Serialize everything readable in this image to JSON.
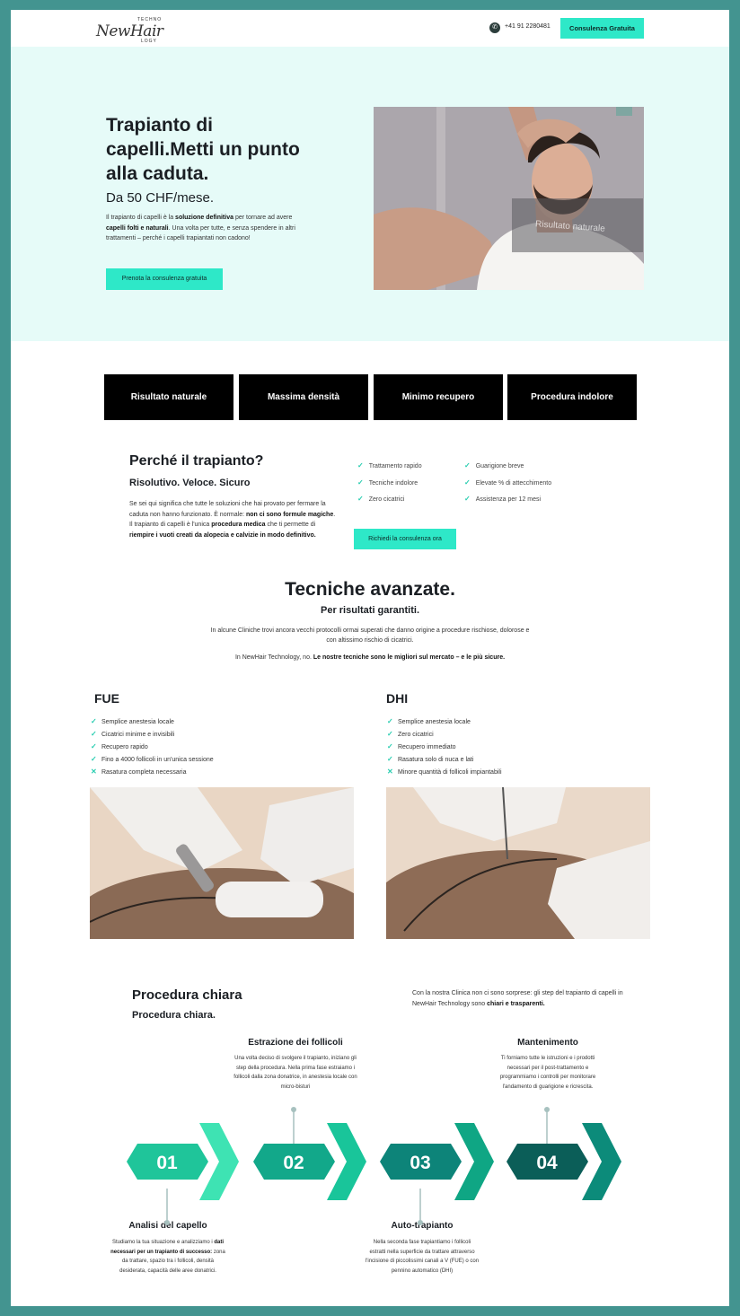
{
  "header": {
    "logo_script": "NewHair",
    "logo_tech": "TECHNO",
    "logo_tech2": "LOGY",
    "phone": "+41 91 2280481",
    "cta": "Consulenza Gratuita"
  },
  "hero": {
    "title": "Trapianto di capelli.Metti un punto alla caduta.",
    "price": "Da 50 CHF/mese.",
    "desc_1": "Il trapianto di capelli è la ",
    "desc_b1": "soluzione definitiva",
    "desc_2": " per tornare ad avere ",
    "desc_b2": "capelli folti e naturali",
    "desc_3": ". Una volta per tutte, e senza spendere in altri trattamenti – perché i capelli trapiantati non cadono!",
    "button": "Prenota la consulenza gratuita",
    "image_overlay": "Risultato naturale"
  },
  "tiles": [
    "Risultato naturale",
    "Massima densità",
    "Minimo recupero",
    "Procedura indolore"
  ],
  "why": {
    "title": "Perché il trapianto?",
    "subtitle": "Risolutivo. Veloce. Sicuro",
    "p1": "Se sei qui significa che tutte le soluzioni che hai provato per fermare la caduta non hanno funzionato. È normale: ",
    "b1": "non ci sono formule magiche",
    "p2": ". Il trapianto di capelli è l'unica ",
    "b2": "procedura medica",
    "p3": " che ti permette di ",
    "b3": "riempire i vuoti creati da alopecia e calvizie in modo definitivo.",
    "checks_left": [
      "Trattamento rapido",
      "Tecniche indolore",
      "Zero cicatrici"
    ],
    "checks_right": [
      "Guarigione breve",
      "Elevate % di attecchimento",
      "Assistenza per 12 mesi"
    ],
    "button": "Richiedi la consulenza ora"
  },
  "tecniche": {
    "title": "Tecniche avanzate.",
    "subtitle": "Per risultati garantiti.",
    "p1": "In alcune Cliniche trovi ancora vecchi protocolli ormai superati che danno origine a procedure rischiose, dolorose e con altissimo rischio di cicatrici.",
    "p2_plain": "In NewHair Technology, no. ",
    "p2_bold": "Le nostre tecniche sono le migliori sul mercato – e le più sicure."
  },
  "fue": {
    "title": "FUE",
    "items": [
      {
        "ok": true,
        "text": "Semplice anestesia locale"
      },
      {
        "ok": true,
        "text": "Cicatrici minime e invisibili"
      },
      {
        "ok": true,
        "text": "Recupero rapido"
      },
      {
        "ok": true,
        "text": "Fino a 4000 follicoli in un'unica sessione"
      },
      {
        "ok": false,
        "text": "Rasatura completa necessaria"
      }
    ]
  },
  "dhi": {
    "title": "DHI",
    "items": [
      {
        "ok": true,
        "text": "Semplice anestesia locale"
      },
      {
        "ok": true,
        "text": "Zero cicatrici"
      },
      {
        "ok": true,
        "text": "Recupero immediato"
      },
      {
        "ok": true,
        "text": "Rasatura solo di nuca e lati"
      },
      {
        "ok": false,
        "text": "Minore quantità di follicoli impiantabili"
      }
    ]
  },
  "procedura": {
    "title": "Procedura chiara",
    "subtitle": "Procedura chiara.",
    "note_1": "Con la nostra Clinica non ci sono sorprese: gli step del trapianto di capelli in NewHair Technology sono ",
    "note_b": "chiari e trasparenti.",
    "steps": [
      {
        "num": "01",
        "title": "Analisi del capello",
        "t1": "Studiamo la tua situazione e analizziamo i ",
        "b": "dati necessari per un trapianto di successo:",
        "t2": " zona da trattare, spazio tra i follicoli, densità desiderata, capacità delle aree donatrici."
      },
      {
        "num": "02",
        "title": "Estrazione dei follicoli",
        "t1": "Una volta deciso di svolgere il trapianto, iniziano gli step della procedura. Nella prima fase estraiamo i follicoli dalla zona donatrice, in anestesia locale con micro-bisturi",
        "b": "",
        "t2": ""
      },
      {
        "num": "03",
        "title": "Auto-trapianto",
        "t1": "Nella seconda fase trapiantiamo i follicoli estratti nella superficie da trattare attraverso l'incisione di piccolissimi canali a V (FUE) o con pennino automatico (DHI)",
        "b": "",
        "t2": ""
      },
      {
        "num": "04",
        "title": "Mantenimento",
        "t1": "Ti forniamo tutte le istruzioni e i prodotti necessari per il post-trattamento e programmiamo i controlli per monitorare l'andamento di guarigione e ricrescita.",
        "b": "",
        "t2": ""
      }
    ]
  },
  "colors": {
    "accent": "#2ee8c8",
    "hero_bg": "#e6fbf8",
    "frame": "#439490",
    "step1": "#1fc59a",
    "step2": "#12a88a",
    "step3": "#0d8479",
    "step4": "#0b5e58"
  }
}
